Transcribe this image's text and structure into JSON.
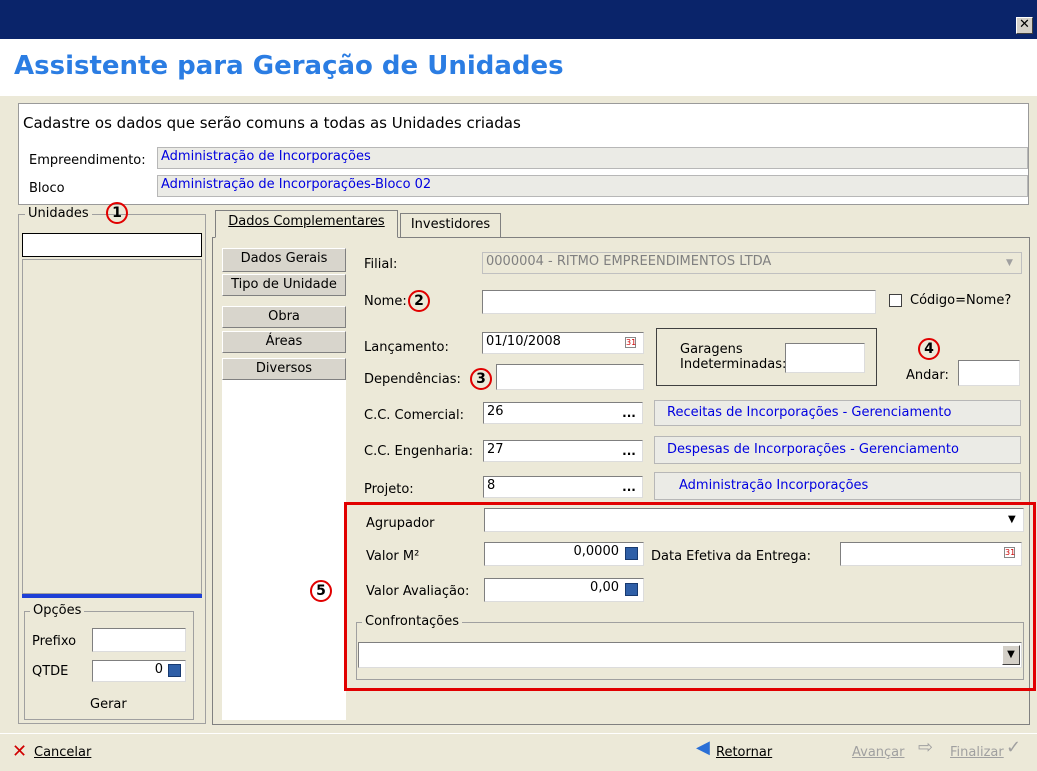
{
  "window": {
    "close_glyph": "✕"
  },
  "header": {
    "title": "Assistente para Geração de Unidades"
  },
  "intro": {
    "text": "Cadastre os dados que serão comuns a todas as Unidades criadas",
    "empreendimento_label": "Empreendimento:",
    "empreendimento_value": "Administração de Incorporações",
    "bloco_label": "Bloco",
    "bloco_value": "Administração de Incorporações-Bloco 02"
  },
  "unidades": {
    "title": "Unidades",
    "marker": "1",
    "options_title": "Opções",
    "prefixo_label": "Prefixo",
    "prefixo_value": "",
    "qtde_label": "QTDE",
    "qtde_value": "0",
    "gerar_label": "Gerar"
  },
  "tabs": [
    {
      "label": "Dados Complementares",
      "active": true
    },
    {
      "label": "Investidores",
      "active": false
    }
  ],
  "side_buttons": [
    "Dados Gerais",
    "Tipo de Unidade",
    "Obra",
    "Áreas",
    "Diversos"
  ],
  "form": {
    "filial_label": "Filial:",
    "filial_value": "0000004 - RITMO EMPREENDIMENTOS LTDA",
    "nome_label": "Nome:",
    "nome_marker": "2",
    "nome_value": "",
    "codigo_nome_label": "Código=Nome?",
    "lancamento_label": "Lançamento:",
    "lancamento_value": "01/10/2008",
    "garagens_label_1": "Garagens",
    "garagens_label_2": "Indeterminadas:",
    "garagens_value": "",
    "andar_marker": "4",
    "andar_label": "Andar:",
    "andar_value": "",
    "dependencias_label": "Dependências:",
    "dependencias_marker": "3",
    "dependencias_value": "",
    "cc_comercial_label": "C.C. Comercial:",
    "cc_comercial_value": "26",
    "cc_comercial_desc": "Receitas de Incorporações - Gerenciamento",
    "cc_engenharia_label": "C.C. Engenharia:",
    "cc_engenharia_value": "27",
    "cc_engenharia_desc": "Despesas de Incorporações - Gerenciamento",
    "projeto_label": "Projeto:",
    "projeto_value": "8",
    "projeto_desc": "Administração Incorporações",
    "dots": "..."
  },
  "highlight": {
    "marker": "5",
    "agrupador_label": "Agrupador",
    "agrupador_value": "",
    "valor_m2_label": "Valor M²",
    "valor_m2_value": "0,0000",
    "data_entrega_label": "Data Efetiva da Entrega:",
    "data_entrega_value": "",
    "valor_avaliacao_label": "Valor Avaliação:",
    "valor_avaliacao_value": "0,00",
    "confrontacoes_label": "Confrontações",
    "confrontacoes_value": ""
  },
  "footer": {
    "cancelar": "Cancelar",
    "retornar": "Retornar",
    "avancar": "Avançar",
    "finalizar": "Finalizar"
  },
  "colors": {
    "title_blue": "#2b7de3",
    "titlebar": "#0a246a",
    "highlight_red": "#e10000",
    "link_blue": "#0000e0"
  }
}
